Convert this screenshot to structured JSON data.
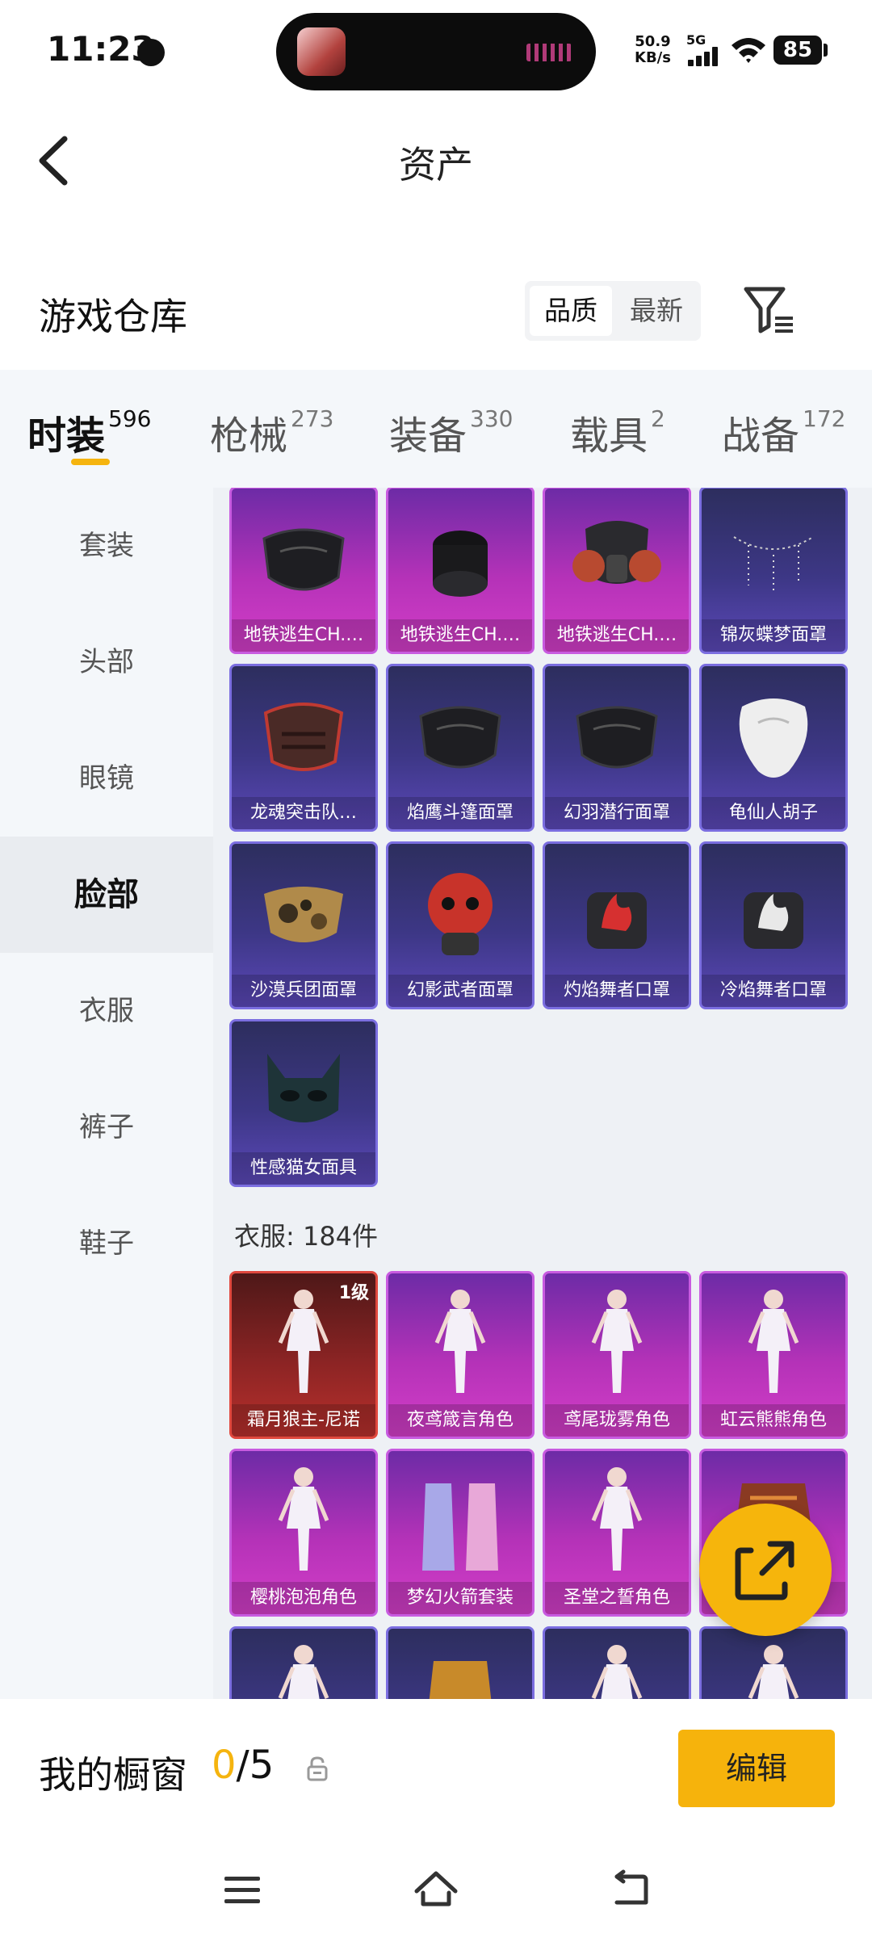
{
  "status_bar": {
    "time": "11:23",
    "speed_value": "50.9",
    "speed_unit": "KB/s",
    "network": "5G",
    "battery": "85"
  },
  "header": {
    "title": "资产"
  },
  "warehouse": {
    "title": "游戏仓库",
    "sort_options": [
      "品质",
      "最新"
    ],
    "active_sort": "品质"
  },
  "tabs": [
    {
      "label": "时装",
      "count": "596",
      "active": true
    },
    {
      "label": "枪械",
      "count": "273"
    },
    {
      "label": "装备",
      "count": "330"
    },
    {
      "label": "载具",
      "count": "2"
    },
    {
      "label": "战备",
      "count": "172"
    }
  ],
  "side_menu": [
    {
      "label": "套装"
    },
    {
      "label": "头部"
    },
    {
      "label": "眼镜"
    },
    {
      "label": "脸部",
      "active": true
    },
    {
      "label": "衣服"
    },
    {
      "label": "裤子"
    },
    {
      "label": "鞋子"
    }
  ],
  "face_items": [
    {
      "name": "地铁逃生CH.…",
      "rarity": "purple",
      "icon": "black-mask"
    },
    {
      "name": "地铁逃生CH.…",
      "rarity": "purple",
      "icon": "neck-gaiter"
    },
    {
      "name": "地铁逃生CH.…",
      "rarity": "purple",
      "icon": "gas-mask"
    },
    {
      "name": "锦灰蝶梦面罩",
      "rarity": "blue",
      "icon": "chain-veil"
    },
    {
      "name": "龙魂突击队…",
      "rarity": "blue",
      "icon": "dragon-mask"
    },
    {
      "name": "焰鹰斗篷面罩",
      "rarity": "blue",
      "icon": "black-mask"
    },
    {
      "name": "幻羽潜行面罩",
      "rarity": "blue",
      "icon": "black-mask"
    },
    {
      "name": "龟仙人胡子",
      "rarity": "blue",
      "icon": "white-beard"
    },
    {
      "name": "沙漠兵团面罩",
      "rarity": "blue",
      "icon": "camo-mask"
    },
    {
      "name": "幻影武者面罩",
      "rarity": "blue",
      "icon": "red-oni-mask"
    },
    {
      "name": "灼焰舞者口罩",
      "rarity": "blue",
      "icon": "flame-gaiter"
    },
    {
      "name": "冷焰舞者口罩",
      "rarity": "blue",
      "icon": "white-flame-gaiter"
    },
    {
      "name": "性感猫女面具",
      "rarity": "blue",
      "icon": "cat-mask"
    }
  ],
  "clothes_section": {
    "label": "衣服: 184件"
  },
  "clothes_items": [
    {
      "name": "霜月狼主-尼诺",
      "rarity": "red",
      "level": "1级",
      "icon": "character"
    },
    {
      "name": "夜鸢箴言角色",
      "rarity": "purple",
      "icon": "character"
    },
    {
      "name": "鸢尾珑雾角色",
      "rarity": "purple",
      "icon": "character"
    },
    {
      "name": "虹云熊熊角色",
      "rarity": "purple",
      "icon": "character"
    },
    {
      "name": "樱桃泡泡角色",
      "rarity": "purple",
      "icon": "character"
    },
    {
      "name": "梦幻火箭套装",
      "rarity": "purple",
      "icon": "suits"
    },
    {
      "name": "圣堂之誓角色",
      "rarity": "purple",
      "icon": "character"
    },
    {
      "name": "装",
      "rarity": "purple",
      "icon": "armor"
    },
    {
      "name": "",
      "rarity": "blue",
      "icon": "character"
    },
    {
      "name": "",
      "rarity": "blue",
      "icon": "outfit"
    },
    {
      "name": "",
      "rarity": "blue",
      "icon": "character"
    },
    {
      "name": "",
      "rarity": "blue",
      "icon": "character"
    }
  ],
  "showcase": {
    "title": "我的橱窗",
    "count_current": "0",
    "count_total": "/5",
    "edit_label": "编辑"
  },
  "colors": {
    "accent": "#f5b40f",
    "purple_rarity": "#b532b8",
    "blue_rarity": "#3d3786",
    "red_rarity": "#8c2424"
  }
}
